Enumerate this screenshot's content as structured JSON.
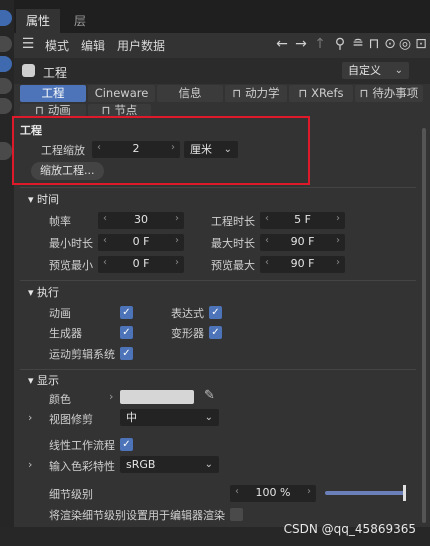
{
  "tabs": {
    "attributes": "属性",
    "layers": "层"
  },
  "menu": {
    "mode": "模式",
    "edit": "编辑",
    "userdata": "用户数据"
  },
  "header": {
    "title": "工程",
    "preset": "自定义"
  },
  "mode_tabs": [
    "工程",
    "Cineware",
    "信息",
    "动力学",
    "XRefs",
    "待办事项",
    "动画",
    "节点"
  ],
  "project": {
    "section_title": "工程",
    "scale_label": "工程缩放",
    "scale_value": "2",
    "scale_unit": "厘米",
    "scale_button": "缩放工程..."
  },
  "time": {
    "section_title": "时间",
    "fps_label": "帧率",
    "fps_value": "30",
    "duration_label": "工程时长",
    "duration_value": "5 F",
    "min_label": "最小时长",
    "min_value": "0 F",
    "max_label": "最大时长",
    "max_value": "90 F",
    "pmin_label": "预览最小",
    "pmin_value": "0 F",
    "pmax_label": "预览最大",
    "pmax_value": "90 F"
  },
  "execute": {
    "section_title": "执行",
    "anim_label": "动画",
    "expr_label": "表达式",
    "gen_label": "生成器",
    "deform_label": "变形器",
    "motion_label": "运动剪辑系统"
  },
  "display": {
    "section_title": "显示",
    "color_label": "颜色",
    "color_value": "#d6d6d6",
    "clip_label": "视图修剪",
    "clip_value": "中",
    "linear_label": "线性工作流程",
    "colorprofile_label": "输入色彩特性",
    "colorprofile_value": "sRGB",
    "lod_label": "细节级别",
    "lod_value": "100 %",
    "lod_fraction": 1.0,
    "render_lod_label": "将渲染细节级别设置用于编辑器渲染"
  },
  "watermark": "CSDN @qq_45869365",
  "colors": {
    "accent": "#4d74b8",
    "highlight": "#e0192a"
  }
}
